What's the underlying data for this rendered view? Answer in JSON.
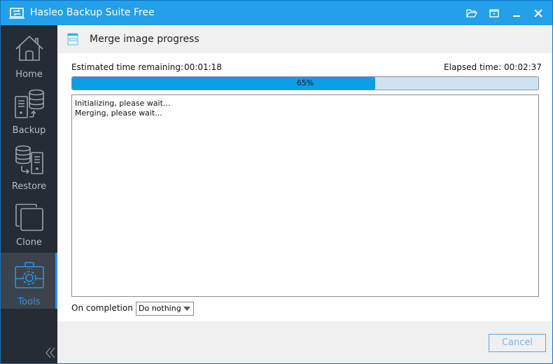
{
  "window": {
    "title": "Hasleo Backup Suite Free",
    "buttons": [
      "folder-open-icon",
      "menu-dropdown-icon",
      "minimize-icon",
      "close-icon"
    ]
  },
  "sidebar": {
    "items": [
      {
        "label": "Home",
        "icon": "home-icon",
        "active": false
      },
      {
        "label": "Backup",
        "icon": "backup-icon",
        "active": false
      },
      {
        "label": "Restore",
        "icon": "restore-icon",
        "active": false
      },
      {
        "label": "Clone",
        "icon": "clone-icon",
        "active": false
      },
      {
        "label": "Tools",
        "icon": "tools-icon",
        "active": true
      }
    ],
    "collapse_icon": "double-chevron-left-icon"
  },
  "page": {
    "title": "Merge image progress",
    "estimated_label": "Estimated time remaining:",
    "estimated_value": "00:01:18",
    "elapsed_label": "Elapsed time:",
    "elapsed_value": "00:02:37",
    "progress_percent": 65,
    "progress_text": "65%",
    "log_lines": [
      "Initializing, please wait...",
      "Merging, please wait..."
    ],
    "completion_label": "On completion",
    "completion_value": "Do nothing"
  },
  "footer": {
    "cancel_label": "Cancel"
  },
  "colors": {
    "titlebar": "#249fea",
    "sidebar": "#262c35",
    "accent": "#2c94e0",
    "progress_fill": "#0a9ee6",
    "progress_track": "#d2e1ef"
  }
}
